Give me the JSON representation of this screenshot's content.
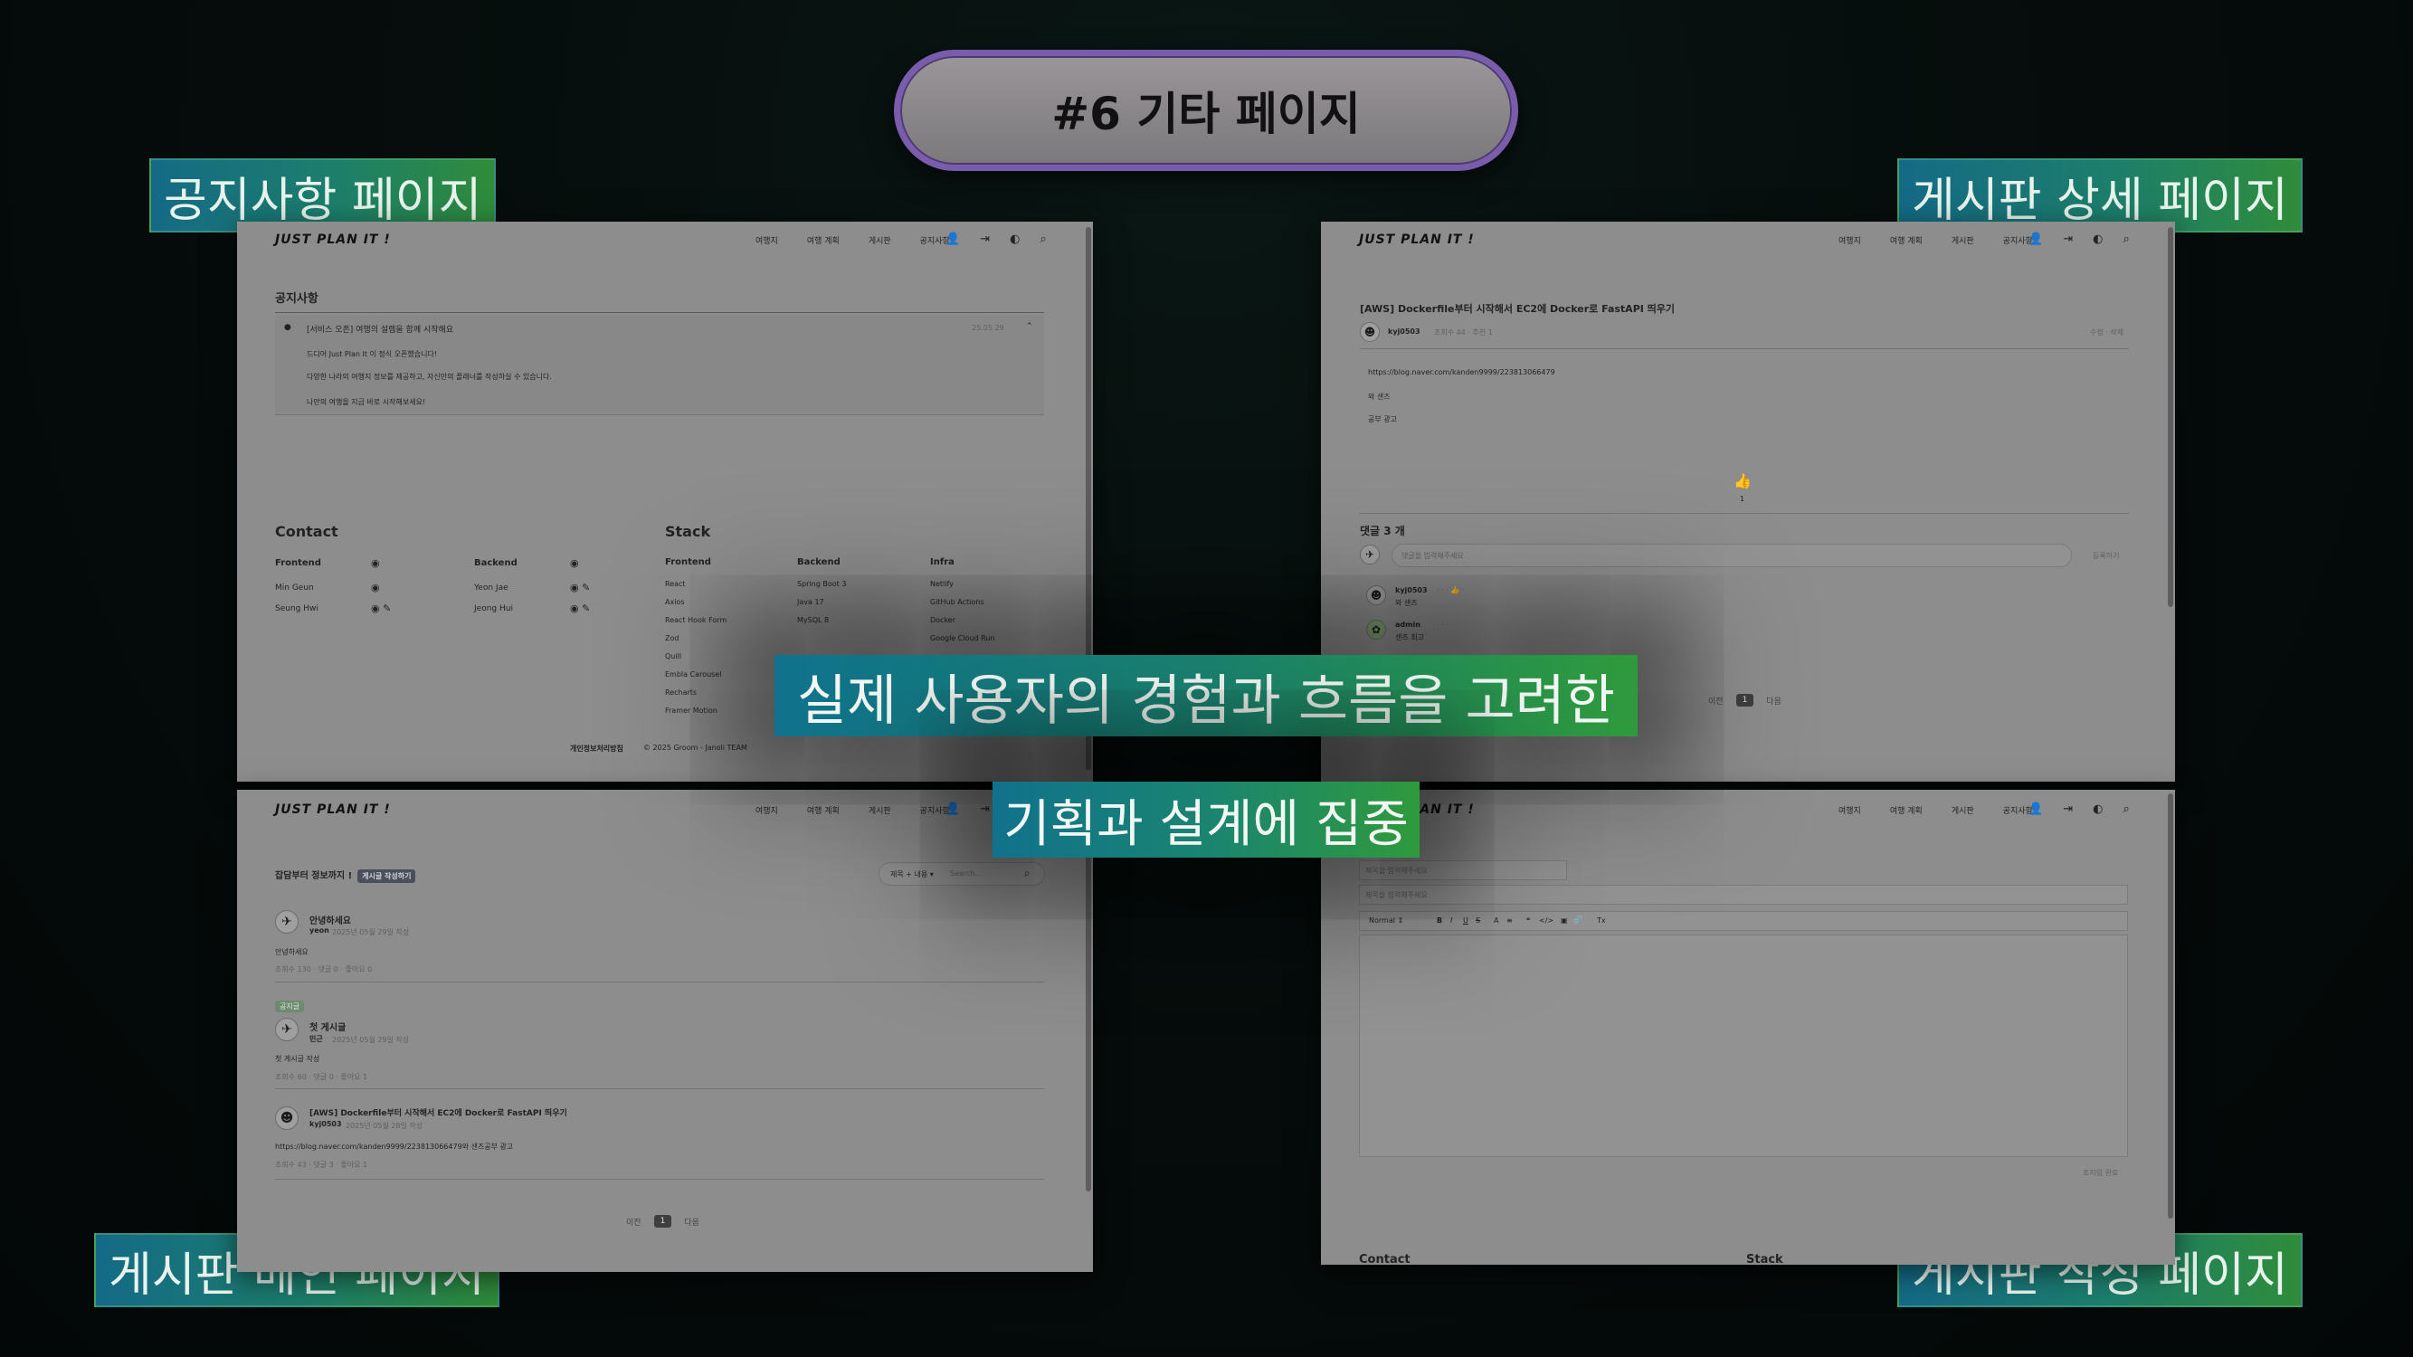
{
  "title": "#6 기타 페이지",
  "tags": {
    "notice": "공지사항 페이지",
    "board_detail": "게시판 상세 페이지",
    "board_main": "게시판 메인 페이지",
    "board_write": "게시판 작성 페이지"
  },
  "captions": {
    "line1": "실제 사용자의 경험과 흐름을 고려한",
    "line2": "기획과 설계에 집중"
  },
  "site": {
    "logo": "JUST PLAN IT !",
    "menu": [
      "여행지",
      "여행 계획",
      "게시판",
      "공지사항"
    ]
  },
  "notice_page": {
    "heading": "공지사항",
    "item_title": "[서비스 오픈] 여행의 설렘을 함께 시작해요",
    "item_date": "25.05.29",
    "body": [
      "드디어 Just Plan It 이 정식 오픈했습니다!",
      "다양한 나라의 여행지 정보를 제공하고, 자신만의 플래너를 작성하실 수 있습니다.",
      "나만의 여행을 지금 바로 시작해보세요!"
    ]
  },
  "footer": {
    "contact_heading": "Contact",
    "frontend_label": "Frontend",
    "backend_label": "Backend",
    "frontend_people": [
      "Min Geun",
      "Seung Hwi"
    ],
    "backend_people": [
      "Yeon Jae",
      "Jeong Hui"
    ],
    "stack_heading": "Stack",
    "stack_frontend_label": "Frontend",
    "stack_backend_label": "Backend",
    "stack_infra_label": "Infra",
    "stack_frontend": [
      "React",
      "Axios",
      "React Hook Form",
      "Zod",
      "Quill",
      "Embla Carousel",
      "Recharts",
      "Framer Motion"
    ],
    "stack_backend": [
      "Spring Boot 3",
      "Java 17",
      "MySQL 8"
    ],
    "stack_infra": [
      "Netlify",
      "GitHub Actions",
      "Docker",
      "Google Cloud Run"
    ],
    "privacy": "개인정보처리방침",
    "copyright": "© 2025 Groom - Janoli TEAM"
  },
  "detail_page": {
    "post_title": "[AWS] Dockerfile부터 시작해서 EC2에 Docker로 FastAPI 띄우기",
    "author": "kyj0503",
    "meta": "조회수 44 · 추천 1",
    "actions": "수정 · 삭제",
    "body": [
      "https://blog.naver.com/kanden9999/223813066479",
      "와 샌즈",
      "공부 광고"
    ],
    "like_count": "1",
    "comments_heading": "댓글 3 개",
    "comment_placeholder": "댓글을 입력해주세요",
    "comment_submit": "등록하기",
    "comments": [
      {
        "author": "kyj0503",
        "text": "와 샌즈"
      },
      {
        "author": "admin",
        "text": "샌즈 최고"
      }
    ],
    "pager": {
      "prev": "이전",
      "current": "1",
      "next": "다음"
    }
  },
  "board_page": {
    "heading": "잡담부터 정보까지 !",
    "write_badge": "게시글 작성하기",
    "search_filter": "제목 + 내용",
    "search_placeholder": "Search...",
    "posts": [
      {
        "title": "안녕하세요",
        "author": "yeon",
        "date": "2025년 05월 29일 작성",
        "excerpt": "안녕하세요",
        "stats": "조회수 130 · 댓글 0 · 좋아요 0",
        "tag": ""
      },
      {
        "title": "첫 게시글",
        "author": "민근",
        "date": "2025년 05월 29일 작성",
        "excerpt": "첫 게시글 작성",
        "stats": "조회수 60 · 댓글 0 · 좋아요 1",
        "tag": "공지글"
      },
      {
        "title": "[AWS] Dockerfile부터 시작해서 EC2에 Docker로 FastAPI 띄우기",
        "author": "kyj0503",
        "date": "2025년 05월 28일 작성",
        "excerpt": "https://blog.naver.com/kanden9999/223813066479와 샌즈공부 광고",
        "stats": "조회수 43 · 댓글 3 · 좋아요 1",
        "tag": ""
      }
    ],
    "pager": {
      "prev": "이전",
      "current": "1",
      "next": "다음"
    }
  },
  "write_page": {
    "title_placeholder": "제목을 입력해주세요",
    "subtitle_placeholder": "제목을 입력해주세요",
    "toolbar_format": "Normal",
    "toolbar_tools": [
      "B",
      "I",
      "U",
      "S",
      "A",
      "≡",
      "❝",
      "</>",
      "▣",
      "🔗",
      "Tx"
    ],
    "submit": "조지림 완료",
    "footer_contact": "Contact",
    "footer_stack": "Stack"
  },
  "colors": {
    "tag_gradient_start": "#146a86",
    "tag_gradient_end": "#2f8c3a",
    "pill_border": "#7a5cad"
  }
}
